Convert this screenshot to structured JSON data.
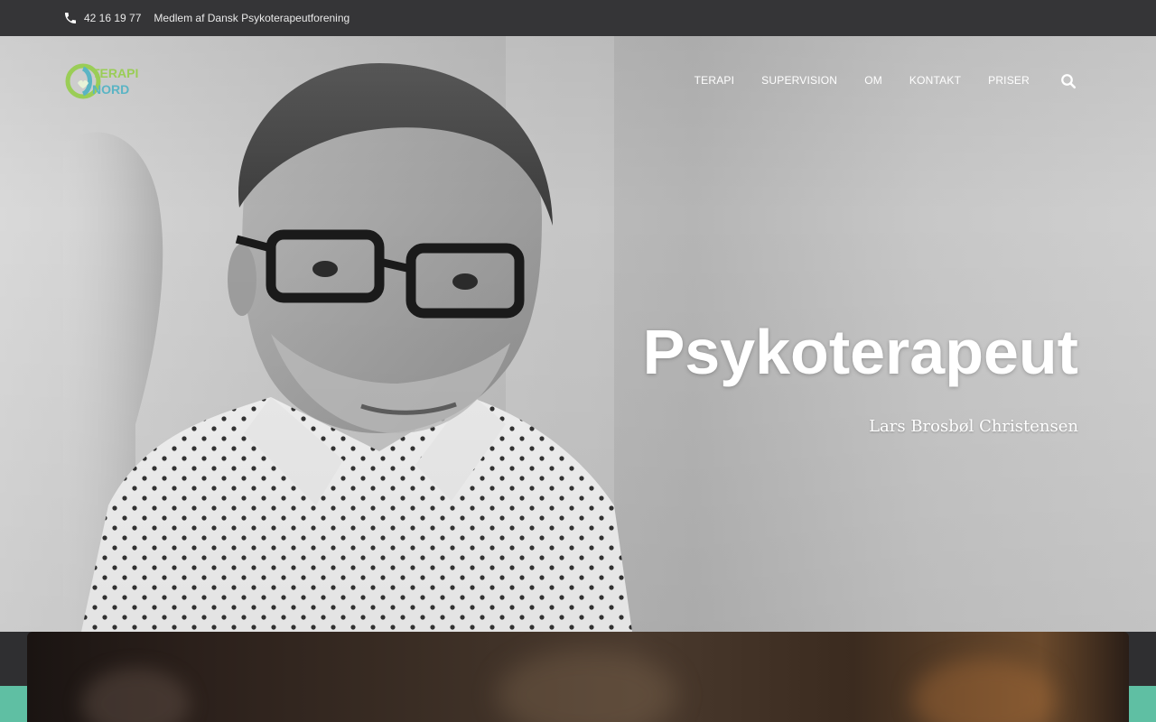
{
  "topbar": {
    "phone": "42 16 19 77",
    "membership": "Medlem af Dansk Psykoterapeutforening"
  },
  "header": {
    "logo_alt": "Terapi Nord",
    "logo_text_top": "TERAPI",
    "logo_text_bottom": "NORD",
    "nav": [
      "TERAPI",
      "SUPERVISION",
      "OM",
      "KONTAKT",
      "PRISER"
    ]
  },
  "hero": {
    "title": "Psykoterapeut",
    "subtitle": "Lars Brosbøl Christensen"
  },
  "colors": {
    "topbar_bg": "#353537",
    "accent_teal": "#5fbfa3",
    "logo_green": "#9acd56",
    "logo_blue": "#5ab4c4"
  },
  "icons": {
    "phone": "phone-icon",
    "search": "search-icon"
  }
}
